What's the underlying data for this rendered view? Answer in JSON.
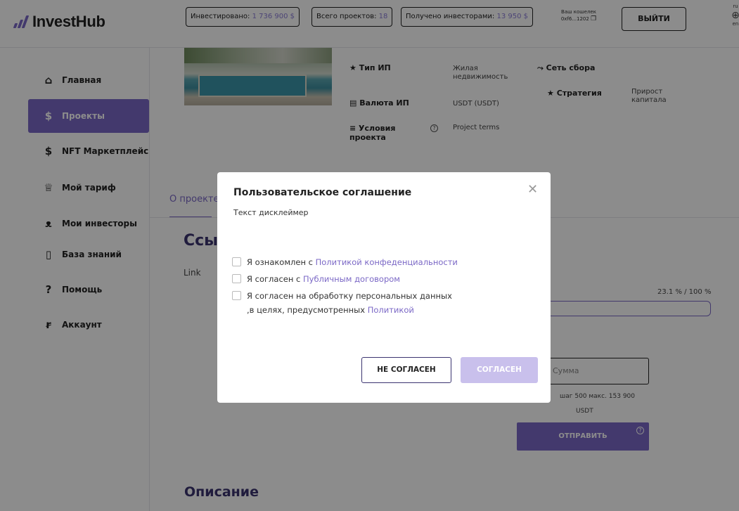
{
  "header": {
    "logo_text": "InvestHub",
    "stats": [
      {
        "label": "Инвестировано:",
        "value": "1 736 900 $"
      },
      {
        "label": "Всего проектов:",
        "value": "18"
      },
      {
        "label": "Получено инвесторами:",
        "value": "13 950 $"
      }
    ],
    "wallet_label": "Ваш кошелек",
    "wallet_address": "0xf6...1202",
    "exit_label": "ВЫЙТИ",
    "lang_top": "ru",
    "lang_bottom": "en"
  },
  "sidebar": {
    "items": [
      {
        "label": "Главная",
        "icon": "home-icon"
      },
      {
        "label": "Проекты",
        "icon": "dollar-icon"
      },
      {
        "label": "NFT Маркетплейс",
        "icon": "hand-coin-icon"
      },
      {
        "label": "Мой тариф",
        "icon": "crown-icon"
      },
      {
        "label": "Мои инвесторы",
        "icon": "users-icon"
      },
      {
        "label": "База знаний",
        "icon": "bookmark-icon"
      },
      {
        "label": "Помощь",
        "icon": "question-icon"
      },
      {
        "label": "Аккаунт",
        "icon": "user-icon"
      }
    ]
  },
  "project": {
    "type_label": "Тип ИП",
    "type_value": "Жилая недвижимость",
    "network_label": "Сеть сбора",
    "currency_label": "Валюта ИП",
    "currency_value": "USDT (USDT)",
    "strategy_label": "Стратегия",
    "strategy_value": "Прирост капитала",
    "terms_label": "Условия проекта",
    "terms_value": "Project terms"
  },
  "main": {
    "tab_about": "О проекте",
    "section_title": "Ссылки",
    "link_label": "Link",
    "progress_text": "23.1 % / 100 %",
    "progress_fraction": 0.231,
    "amount_placeholder": "Сумма",
    "step_text": "шаг 500   макс. 153 900",
    "currency_unit": "USDT",
    "send_label": "ОТПРАВИТЬ",
    "description_title": "Описание"
  },
  "modal": {
    "title": "Пользовательское соглашение",
    "subtitle": "Текст дисклеймер",
    "checks": [
      {
        "text": "Я ознакомлен с ",
        "link": "Политикой конфеденциальности"
      },
      {
        "text": "Я согласен с ",
        "link": "Публичным договором"
      },
      {
        "text": "Я согласен на обработку персональных данных ,в целях, предусмотренных ",
        "link": "Политикой"
      }
    ],
    "disagree_label": "НЕ СОГЛАСЕН",
    "agree_label": "СОГЛАСЕН"
  },
  "colors": {
    "accent": "#7b68c6",
    "accent_light": "#c9c0ec",
    "dark_heading": "#3b3470"
  }
}
